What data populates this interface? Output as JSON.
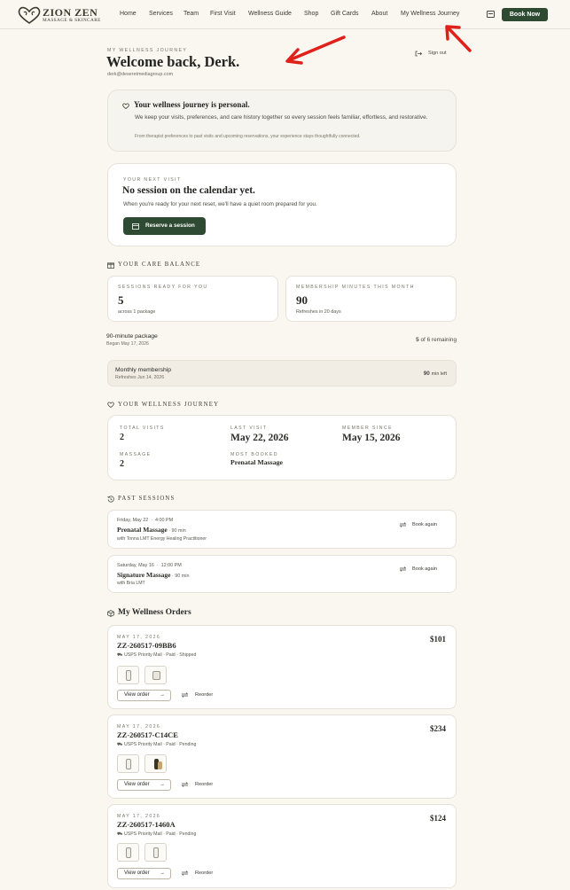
{
  "brand": {
    "name": "ZION ZEN",
    "tagline": "MASSAGE & SKINCARE"
  },
  "nav": {
    "items": [
      {
        "label": "Home",
        "name": "nav-home"
      },
      {
        "label": "Services",
        "name": "nav-services"
      },
      {
        "label": "Team",
        "name": "nav-team"
      },
      {
        "label": "First Visit",
        "name": "nav-first-visit"
      },
      {
        "label": "Wellness Guide",
        "name": "nav-wellness-guide"
      },
      {
        "label": "Shop",
        "name": "nav-shop"
      },
      {
        "label": "Gift Cards",
        "name": "nav-gift-cards"
      },
      {
        "label": "About",
        "name": "nav-about"
      },
      {
        "label": "My Wellness Journey",
        "name": "nav-my-wellness-journey"
      }
    ],
    "book_now": "Book Now"
  },
  "colors": {
    "accent": "#2f4a33",
    "annotation": "#e0201a",
    "background": "#faf7f1"
  },
  "profile": {
    "eyebrow": "MY WELLNESS JOURNEY",
    "welcome": "Welcome back, Derk.",
    "email": "derk@deseretmediagroup.com",
    "sign_out": "Sign out"
  },
  "intro": {
    "title": "Your wellness journey is personal.",
    "body": "We keep your visits, preferences, and care history together so every session feels familiar, effortless, and restorative.",
    "note": "From therapist preferences to past visits and upcoming reservations, your experience stays thoughtfully connected."
  },
  "next_visit": {
    "eyebrow": "YOUR NEXT VISIT",
    "title": "No session on the calendar yet.",
    "body": "When you're ready for your next reset, we'll have a quiet room prepared for you.",
    "button": "Reserve a session"
  },
  "care_balance": {
    "heading": "YOUR CARE BALANCE",
    "sessions": {
      "label": "SESSIONS READY FOR YOU",
      "value": "5",
      "sub": "across 1 package"
    },
    "minutes": {
      "label": "MEMBERSHIP MINUTES THIS MONTH",
      "value": "90",
      "sub": "Refreshes in 20 days"
    },
    "package": {
      "title": "90-minute package",
      "sub": "Began May 17, 2026",
      "remaining_num": "5",
      "remaining_text": "of 6 remaining"
    },
    "membership": {
      "title": "Monthly membership",
      "sub": "Refreshes Jun 14, 2026",
      "minutes_num": "90",
      "minutes_text": "min left"
    }
  },
  "journey": {
    "heading": "YOUR WELLNESS JOURNEY",
    "total_visits": {
      "label": "TOTAL VISITS",
      "value": "2"
    },
    "last_visit": {
      "label": "LAST VISIT",
      "value": "May 22, 2026"
    },
    "member_since": {
      "label": "MEMBER SINCE",
      "value": "May 15, 2026"
    },
    "massage": {
      "label": "MASSAGE",
      "value": "2"
    },
    "most_booked": {
      "label": "MOST BOOKED",
      "value": "Prenatal Massage"
    }
  },
  "past_sessions": {
    "heading": "PAST SESSIONS",
    "items": [
      {
        "date": "Friday, May 22",
        "time": "4:00 PM",
        "service": "Prenatal Massage",
        "duration": "90 min",
        "with": "with Tonna LMT Energy Healing Practitioner",
        "action": "Book again"
      },
      {
        "date": "Saturday, May 16",
        "time": "12:00 PM",
        "service": "Signature Massage",
        "duration": "90 min",
        "with": "with Bria LMT",
        "action": "Book again"
      }
    ]
  },
  "orders": {
    "heading": "My Wellness Orders",
    "view_label": "View order",
    "reorder_label": "Reorder",
    "items": [
      {
        "date": "MAY 17, 2026",
        "id": "ZZ-260517-09BB6",
        "shipping": "USPS Priority Mail",
        "payment": "Paid",
        "status": "Shipped",
        "total": "$101"
      },
      {
        "date": "MAY 17, 2026",
        "id": "ZZ-260517-C14CE",
        "shipping": "USPS Priority Mail",
        "payment": "Paid",
        "status": "Pending",
        "total": "$234"
      },
      {
        "date": "MAY 17, 2026",
        "id": "ZZ-260517-1460A",
        "shipping": "USPS Priority Mail",
        "payment": "Paid",
        "status": "Pending",
        "total": "$124"
      }
    ]
  }
}
